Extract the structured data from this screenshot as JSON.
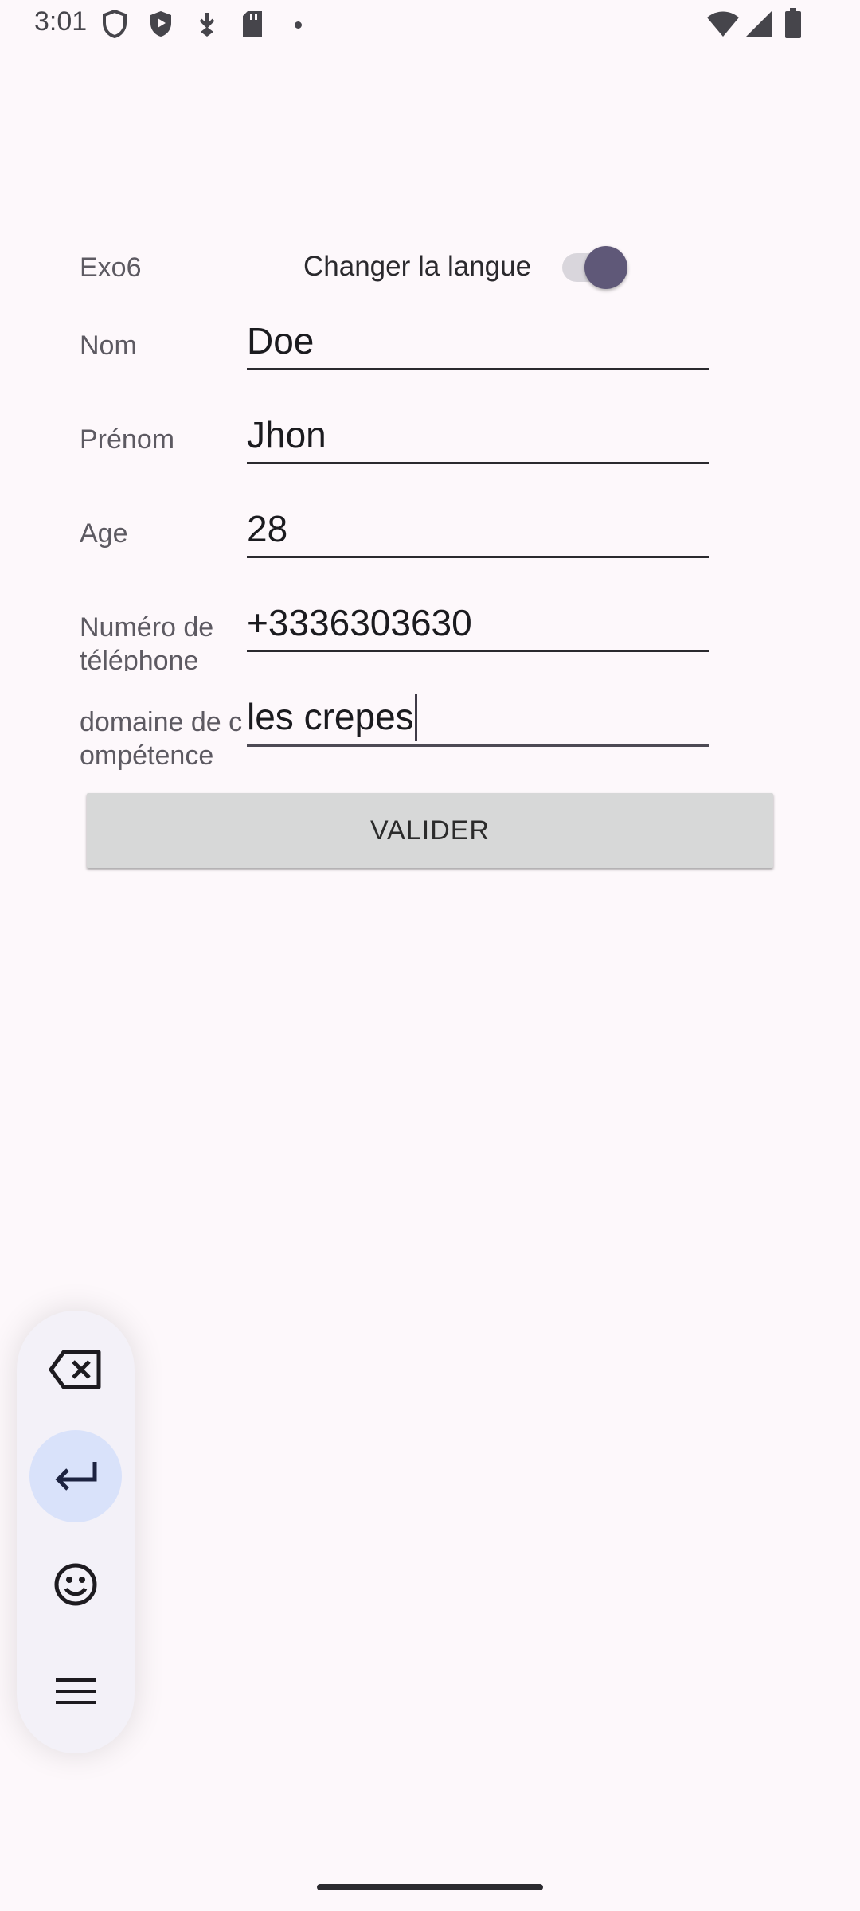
{
  "status_bar": {
    "time": "3:01",
    "left_icons": [
      "shield-outline-icon",
      "shield-play-icon",
      "download-icon",
      "sd-card-icon",
      "dot-icon"
    ],
    "right_icons": [
      "wifi-icon",
      "cellular-signal-icon",
      "battery-icon"
    ]
  },
  "header": {
    "app_title": "Exo6",
    "language_switch_label": "Changer la langue",
    "language_switch_on": true
  },
  "form": {
    "fields": [
      {
        "label": "Nom",
        "value": "Doe"
      },
      {
        "label": "Prénom",
        "value": "Jhon"
      },
      {
        "label": "Age",
        "value": "28"
      },
      {
        "label": "Numéro de téléphone",
        "value": "+3336303630"
      },
      {
        "label": "domaine de compétence",
        "value": "les crepes"
      }
    ],
    "submit_label": "VALIDER"
  },
  "keyboard_toolbar": {
    "buttons": [
      "backspace-icon",
      "enter-icon",
      "emoji-icon",
      "menu-icon"
    ],
    "active": "enter-icon"
  },
  "colors": {
    "background": "#fdf8fb",
    "switch_thumb": "#5f5878",
    "button_bg": "#d7d8d8",
    "toolbar_active": "#d9e2fa"
  }
}
